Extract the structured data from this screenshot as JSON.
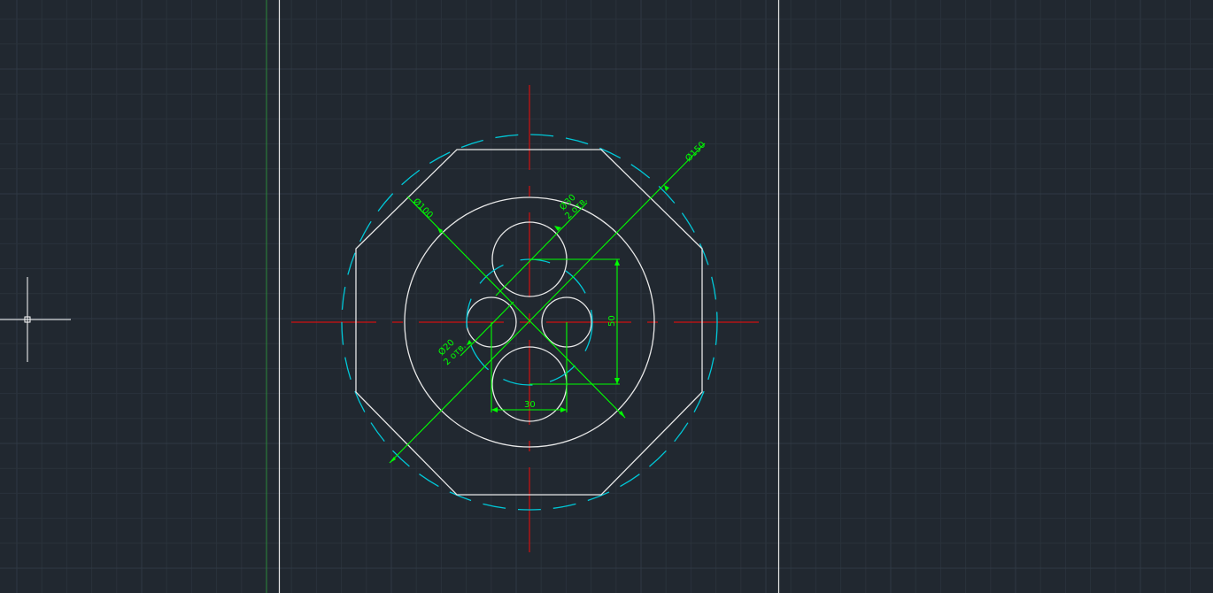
{
  "colors": {
    "background": "#212830",
    "grid_minor": "#2a323b",
    "grid_major": "#303944",
    "geometry": "#e8e8e8",
    "centerline": "#d01010",
    "hidden": "#00c8d8",
    "dimension": "#00ff00",
    "ucs_y_axis": "#2a8a3a",
    "cursor": "#ffffff"
  },
  "dimensions": {
    "outer_diameter": "Ø150",
    "circle_diameter": "Ø100",
    "upper_holes_diameter": "Ø30",
    "upper_holes_count": "2 отв.",
    "side_holes_diameter": "Ø20",
    "side_holes_count": "2 отв.",
    "vertical_spacing": "50",
    "horizontal_spacing": "30"
  }
}
